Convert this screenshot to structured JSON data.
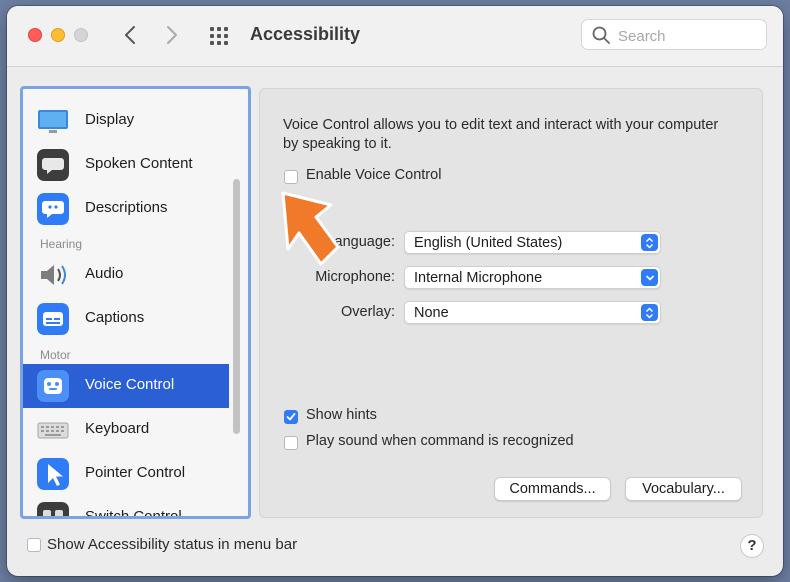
{
  "window": {
    "title": "Accessibility"
  },
  "search": {
    "placeholder": "Search"
  },
  "sidebar": {
    "items": [
      {
        "label": "Display",
        "icon": "display-icon"
      },
      {
        "label": "Spoken Content",
        "icon": "spoken-content-icon"
      },
      {
        "label": "Descriptions",
        "icon": "descriptions-icon"
      },
      {
        "label": "Audio",
        "icon": "speaker-icon"
      },
      {
        "label": "Captions",
        "icon": "captions-icon"
      },
      {
        "label": "Voice Control",
        "icon": "voice-control-icon",
        "selected": true
      },
      {
        "label": "Keyboard",
        "icon": "keyboard-icon"
      },
      {
        "label": "Pointer Control",
        "icon": "pointer-icon"
      },
      {
        "label": "Switch Control",
        "icon": "switch-control-icon"
      }
    ],
    "sections": {
      "hearing": "Hearing",
      "motor": "Motor"
    }
  },
  "panel": {
    "description": "Voice Control allows you to edit text and interact with your computer by speaking to it.",
    "enable_label": "Enable Voice Control",
    "enable_checked": false,
    "language_label": "Language:",
    "language_value": "English (United States)",
    "microphone_label": "Microphone:",
    "microphone_value": "Internal Microphone",
    "overlay_label": "Overlay:",
    "overlay_value": "None",
    "show_hints_label": "Show hints",
    "show_hints_checked": true,
    "play_sound_label": "Play sound when command is recognized",
    "play_sound_checked": false,
    "commands_button": "Commands...",
    "vocabulary_button": "Vocabulary..."
  },
  "footer": {
    "status_label": "Show Accessibility status in menu bar",
    "status_checked": false,
    "help_label": "?"
  },
  "colors": {
    "accent": "#2f7cf6",
    "selection": "#2b60d4",
    "annotation_arrow": "#f07a2a"
  }
}
